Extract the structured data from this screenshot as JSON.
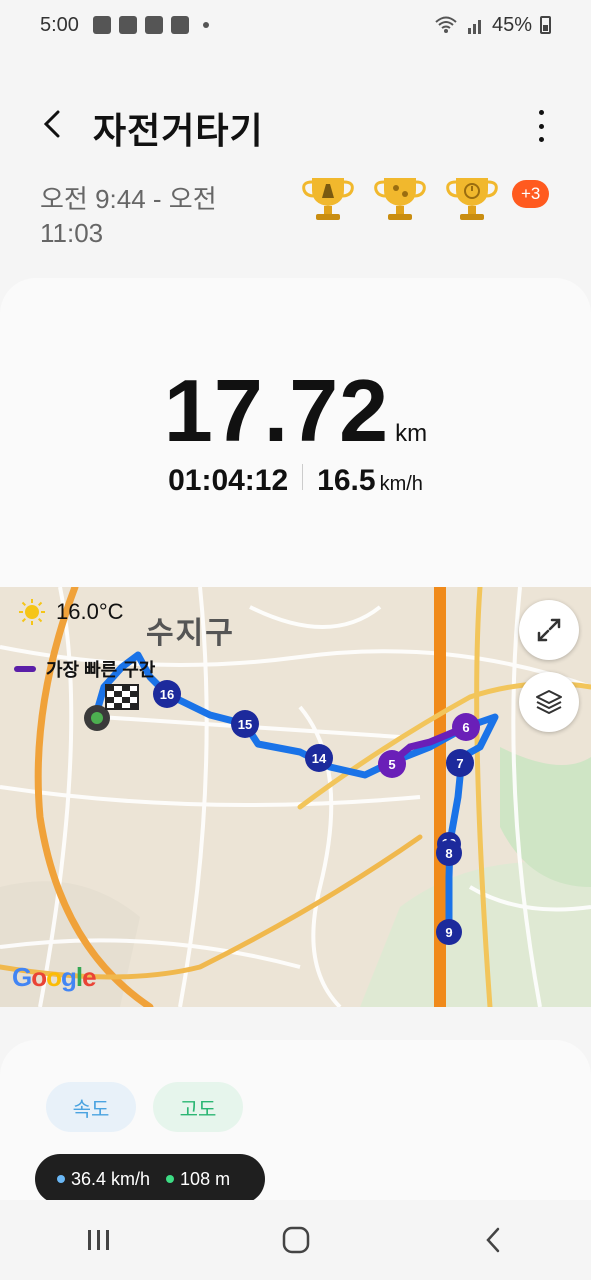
{
  "status": {
    "time": "5:00",
    "battery": "45%"
  },
  "header": {
    "title": "자전거타기"
  },
  "time_range": "오전 9:44 - 오전 11:03",
  "badge_more": "+3",
  "summary": {
    "distance": "17.72",
    "distance_unit": "km",
    "duration": "01:04:12",
    "speed": "16.5",
    "speed_unit": "km/h"
  },
  "map": {
    "weather": "16.0°C",
    "fastest_label": "가장 빠른 구간",
    "district": "수지구",
    "google": "Google",
    "markers": [
      "16",
      "15",
      "14",
      "5",
      "6",
      "7",
      "8",
      "9",
      "10"
    ]
  },
  "chips": {
    "speed": "속도",
    "altitude": "고도"
  },
  "legend": {
    "speed": "36.4 km/h",
    "altitude": "108 m"
  },
  "colors": {
    "route": "#1a73e8",
    "fast": "#6a1fb8",
    "marker": "#1c2a9c",
    "badge": "#ff5a1f"
  }
}
